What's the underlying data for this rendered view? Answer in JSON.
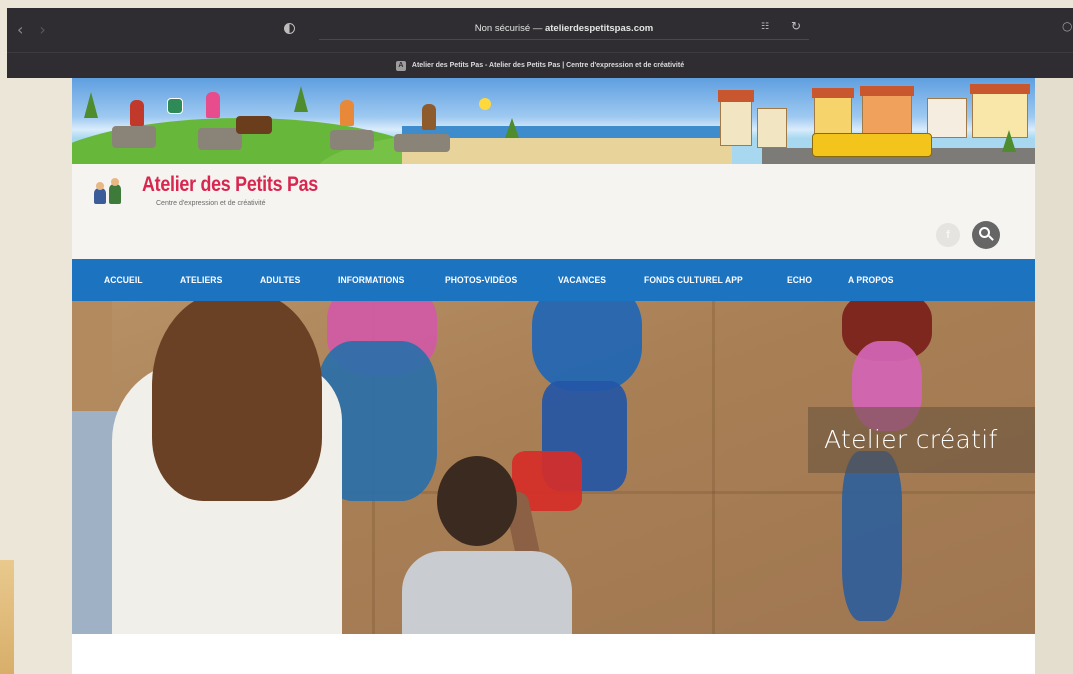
{
  "browser": {
    "security_label": "Non sécurisé —",
    "host": "atelierdespetitspas.com",
    "tab_title": "Atelier des Petits Pas - Atelier des Petits Pas | Centre d'expression et de créativité"
  },
  "site": {
    "title": "Atelier des Petits Pas",
    "tagline": "Centre d'expression et de créativité"
  },
  "nav": {
    "items": [
      "ACCUEIL",
      "ATELIERS",
      "ADULTES",
      "INFORMATIONS",
      "PHOTOS-VIDÉOS",
      "VACANCES",
      "FONDS CULTUREL APP",
      "ECHO",
      "A PROPOS"
    ]
  },
  "hero": {
    "caption": "Atelier créatif"
  },
  "colors": {
    "nav_blue": "#1c73c0",
    "brand_pink": "#d8264f",
    "browser_dark": "#2f2d31"
  },
  "icons": {
    "back": "chevron-left-icon",
    "forward": "chevron-right-icon",
    "privacy": "shield-icon",
    "translate": "translate-icon",
    "reload": "reload-icon",
    "facebook": "facebook-icon",
    "search": "search-icon"
  }
}
